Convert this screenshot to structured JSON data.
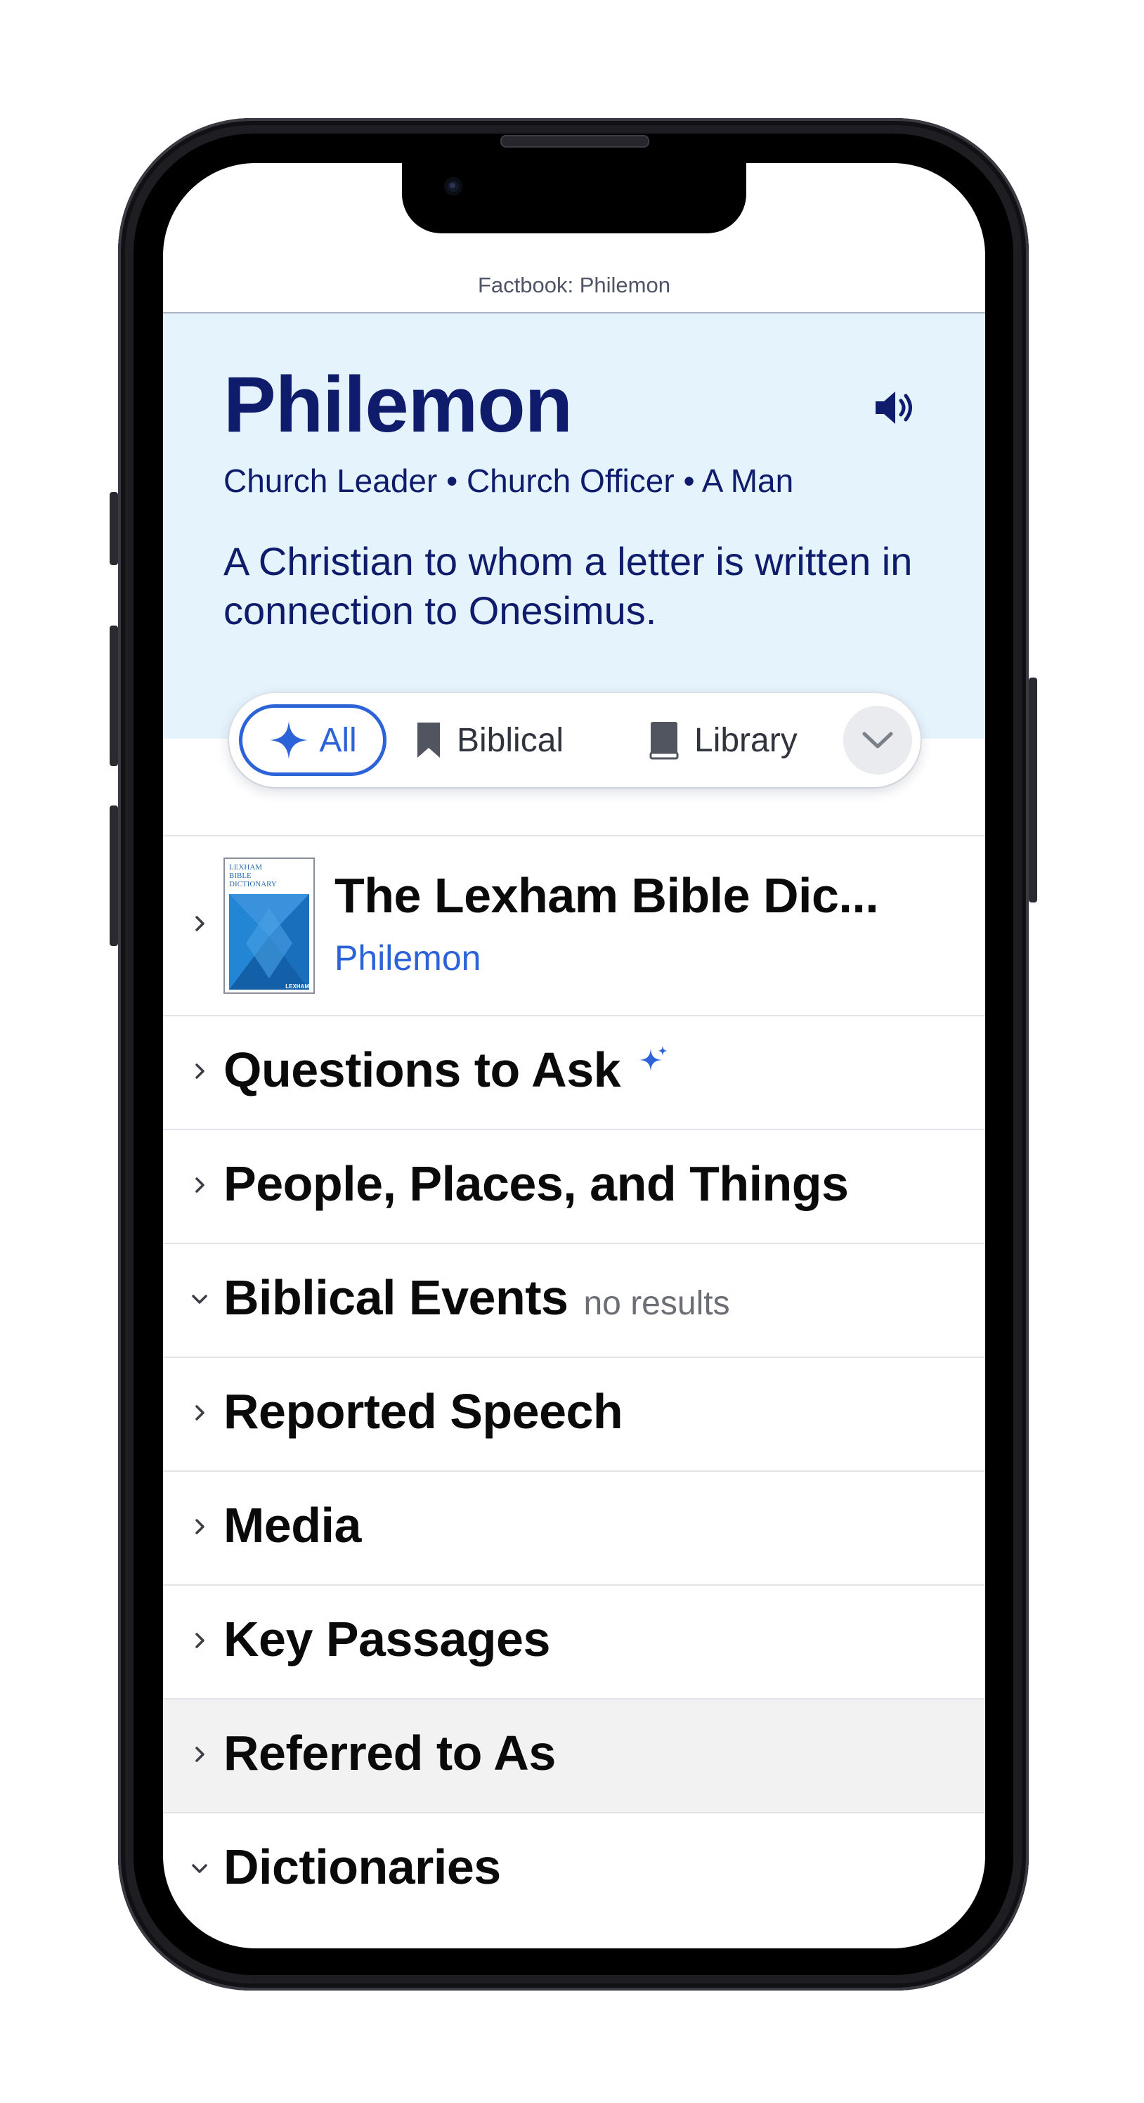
{
  "nav": {
    "title": "Factbook: Philemon"
  },
  "hero": {
    "title": "Philemon",
    "subtitle": "Church Leader • Church Officer • A Man",
    "description": "A Christian to whom a letter is written in connection to Onesimus.",
    "audio_icon": "speaker-icon"
  },
  "filters": {
    "items": [
      {
        "label": "All",
        "icon": "sparkle-icon",
        "selected": true
      },
      {
        "label": "Biblical",
        "icon": "bookmark-icon",
        "selected": false
      },
      {
        "label": "Library",
        "icon": "book-icon",
        "selected": false
      }
    ],
    "more_icon": "chevron-down-icon"
  },
  "resource": {
    "title": "The Lexham Bible Dic...",
    "subtitle": "Philemon",
    "cover_text": "LEXHAM\nBIBLE\nDICTIONARY",
    "cover_brand": "LEXHAM"
  },
  "sections": [
    {
      "label": "Questions to Ask",
      "expanded": false,
      "badge_icon": "sparkle-icon"
    },
    {
      "label": "People, Places, and Things",
      "expanded": false
    },
    {
      "label": "Biblical Events",
      "expanded": true,
      "note": "no results"
    },
    {
      "label": "Reported Speech",
      "expanded": false
    },
    {
      "label": "Media",
      "expanded": false
    },
    {
      "label": "Key Passages",
      "expanded": false
    },
    {
      "label": "Referred to As",
      "expanded": false,
      "highlighted": true
    },
    {
      "label": "Dictionaries",
      "expanded": true
    }
  ],
  "colors": {
    "accent": "#2c63d8",
    "hero_bg": "#e5f3fd",
    "hero_text": "#0f1b6b",
    "highlight_row": "#f2f2f3"
  }
}
